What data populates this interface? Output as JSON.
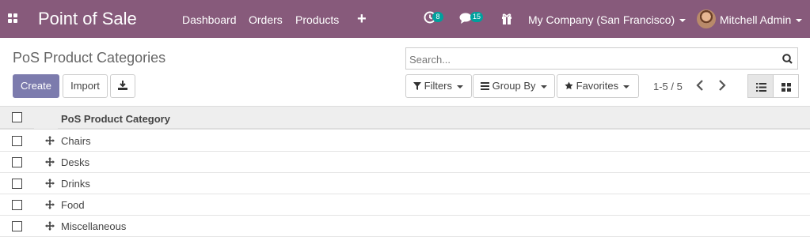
{
  "navbar": {
    "brand": "Point of Sale",
    "menus": [
      "Dashboard",
      "Orders",
      "Products"
    ],
    "activity_count": "8",
    "messages_count": "15",
    "company": "My Company (San Francisco)",
    "user": "Mitchell Admin",
    "color": "#875a7b"
  },
  "control": {
    "title": "PoS Product Categories",
    "search_placeholder": "Search...",
    "create_label": "Create",
    "import_label": "Import",
    "filters_label": "Filters",
    "groupby_label": "Group By",
    "favorites_label": "Favorites",
    "pager": "1-5 / 5",
    "primary_color": "#7c7bad"
  },
  "table": {
    "column": "PoS Product Category",
    "rows": [
      "Chairs",
      "Desks",
      "Drinks",
      "Food",
      "Miscellaneous"
    ]
  },
  "icons": [
    "apps-icon",
    "plus-icon",
    "activity-icon",
    "messages-icon",
    "gift-icon",
    "search-icon",
    "download-icon",
    "filter-icon",
    "groupby-icon",
    "star-icon",
    "chevron-left-icon",
    "chevron-right-icon",
    "list-view-icon",
    "kanban-view-icon",
    "drag-handle-icon"
  ]
}
